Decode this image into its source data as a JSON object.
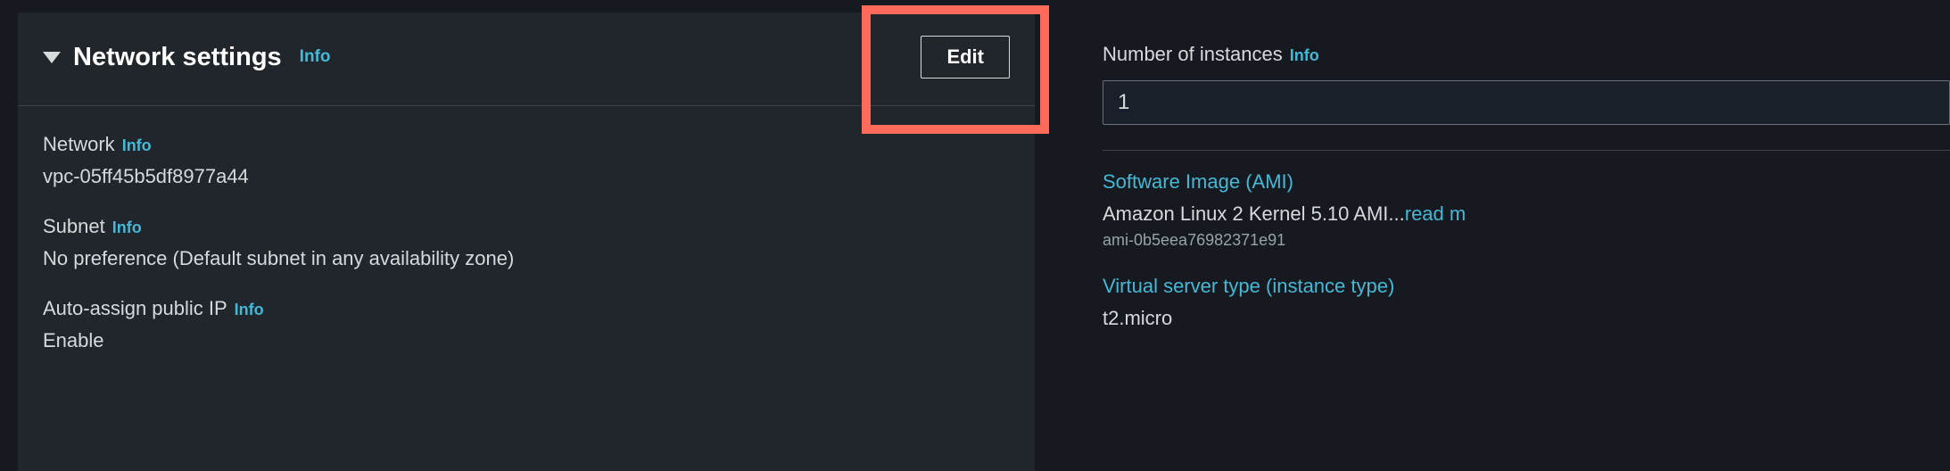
{
  "networkSettings": {
    "title": "Network settings",
    "infoLabel": "Info",
    "editLabel": "Edit",
    "fields": {
      "network": {
        "label": "Network",
        "info": "Info",
        "value": "vpc-05ff45b5df8977a44"
      },
      "subnet": {
        "label": "Subnet",
        "info": "Info",
        "value": "No preference (Default subnet in any availability zone)"
      },
      "publicIp": {
        "label": "Auto-assign public IP",
        "info": "Info",
        "value": "Enable"
      }
    }
  },
  "summary": {
    "instances": {
      "label": "Number of instances",
      "info": "Info",
      "value": "1"
    },
    "ami": {
      "heading": "Software Image (AMI)",
      "description": "Amazon Linux 2 Kernel 5.10 AMI...",
      "readMore": "read m",
      "id": "ami-0b5eea76982371e91"
    },
    "instanceType": {
      "heading": "Virtual server type (instance type)",
      "value": "t2.micro"
    }
  }
}
